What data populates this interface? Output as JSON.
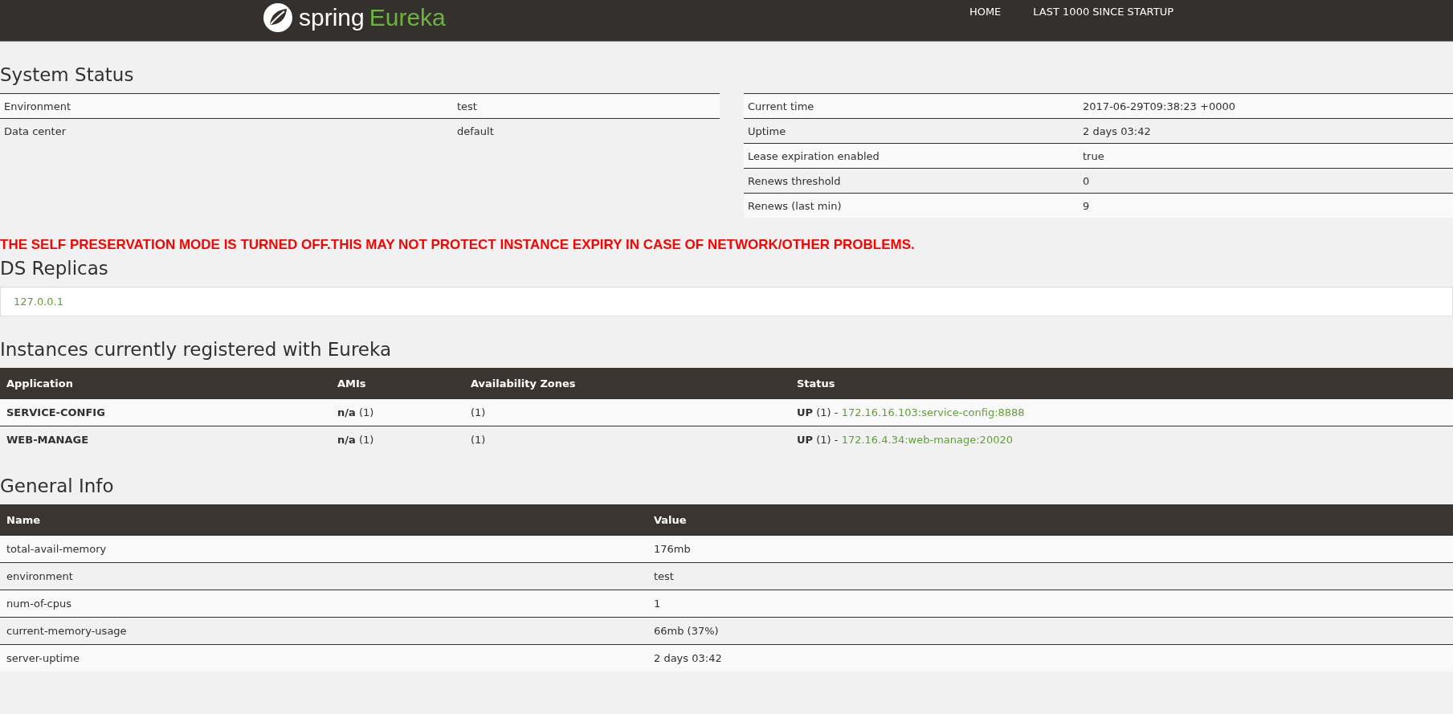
{
  "header": {
    "logo": {
      "brand": "spring",
      "product": "Eureka"
    },
    "nav": [
      {
        "label": "HOME"
      },
      {
        "label": "LAST 1000 SINCE STARTUP"
      }
    ]
  },
  "system_status": {
    "title": "System Status",
    "left": [
      {
        "label": "Environment",
        "value": "test"
      },
      {
        "label": "Data center",
        "value": "default"
      }
    ],
    "right": [
      {
        "label": "Current time",
        "value": "2017-06-29T09:38:23 +0000"
      },
      {
        "label": "Uptime",
        "value": "2 days 03:42"
      },
      {
        "label": "Lease expiration enabled",
        "value": "true"
      },
      {
        "label": "Renews threshold",
        "value": "0"
      },
      {
        "label": "Renews (last min)",
        "value": "9"
      }
    ]
  },
  "warning": "THE SELF PRESERVATION MODE IS TURNED OFF.THIS MAY NOT PROTECT INSTANCE EXPIRY IN CASE OF NETWORK/OTHER PROBLEMS.",
  "ds_replicas": {
    "title": "DS Replicas",
    "items": [
      {
        "label": "127.0.0.1"
      }
    ]
  },
  "instances": {
    "title": "Instances currently registered with Eureka",
    "columns": [
      "Application",
      "AMIs",
      "Availability Zones",
      "Status"
    ],
    "rows": [
      {
        "application": "SERVICE-CONFIG",
        "ami": "n/a",
        "ami_count": "(1)",
        "zones": "(1)",
        "status": "UP",
        "status_count": "(1)",
        "separator": "-",
        "link": "172.16.16.103:service-config:8888"
      },
      {
        "application": "WEB-MANAGE",
        "ami": "n/a",
        "ami_count": "(1)",
        "zones": "(1)",
        "status": "UP",
        "status_count": "(1)",
        "separator": "-",
        "link": "172.16.4.34:web-manage:20020"
      }
    ]
  },
  "general_info": {
    "title": "General Info",
    "columns": [
      "Name",
      "Value"
    ],
    "rows": [
      {
        "name": "total-avail-memory",
        "value": "176mb"
      },
      {
        "name": "environment",
        "value": "test"
      },
      {
        "name": "num-of-cpus",
        "value": "1"
      },
      {
        "name": "current-memory-usage",
        "value": "66mb (37%)"
      },
      {
        "name": "server-uptime",
        "value": "2 days 03:42"
      }
    ]
  }
}
